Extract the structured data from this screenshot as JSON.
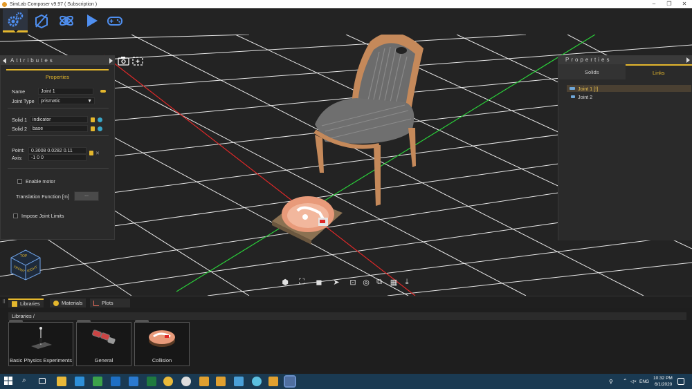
{
  "window": {
    "title": "SimLab Composer v9.97 ( Subscription )",
    "controls": [
      "–",
      "❐",
      "✕"
    ]
  },
  "toolbar": {
    "items": [
      {
        "name": "settings",
        "active": true
      },
      {
        "name": "scene"
      },
      {
        "name": "physics"
      },
      {
        "name": "play"
      },
      {
        "name": "vr-controller"
      }
    ]
  },
  "attributes": {
    "header": "Attributes",
    "section": "Properties",
    "name_label": "Name",
    "name_value": "Joint 1",
    "joint_type_label": "Joint Type",
    "joint_type_value": "prismatic",
    "solid1_label": "Solid 1",
    "solid1_value": "indicator",
    "solid2_label": "Solid 2",
    "solid2_value": "base",
    "point_label": "Point:",
    "point_value": "0.3008 0.0282 0.11",
    "axis_label": "Axis:",
    "axis_value": "-1 0 0",
    "enable_motor_label": "Enable motor",
    "translation_label": "Translation Function [m]",
    "translation_value": "...",
    "impose_limits_label": "Impose Joint Limits"
  },
  "properties": {
    "header": "Properties",
    "tabs": [
      "Solids",
      "Links"
    ],
    "active_tab": "Links",
    "tree": [
      "Joint 1 [!]",
      "Joint 2"
    ]
  },
  "navcube": {
    "front": "FRONT",
    "right": "RIGHT",
    "top": "TOP"
  },
  "bottom": {
    "tabs": [
      "Libraries",
      "Materials",
      "Plots"
    ],
    "active_tab": "Libraries",
    "breadcrumb": "Libraries  /",
    "cards": [
      "Basic Physics Experiments",
      "General",
      "Collision"
    ]
  },
  "taskbar": {
    "time": "10:32 PM",
    "date": "6/1/2020",
    "lang": "ENG"
  },
  "colors": {
    "accent": "#e4b72d",
    "panel": "#2a2a2a",
    "viewport": "#232323",
    "taskbar": "#1a3a52"
  }
}
